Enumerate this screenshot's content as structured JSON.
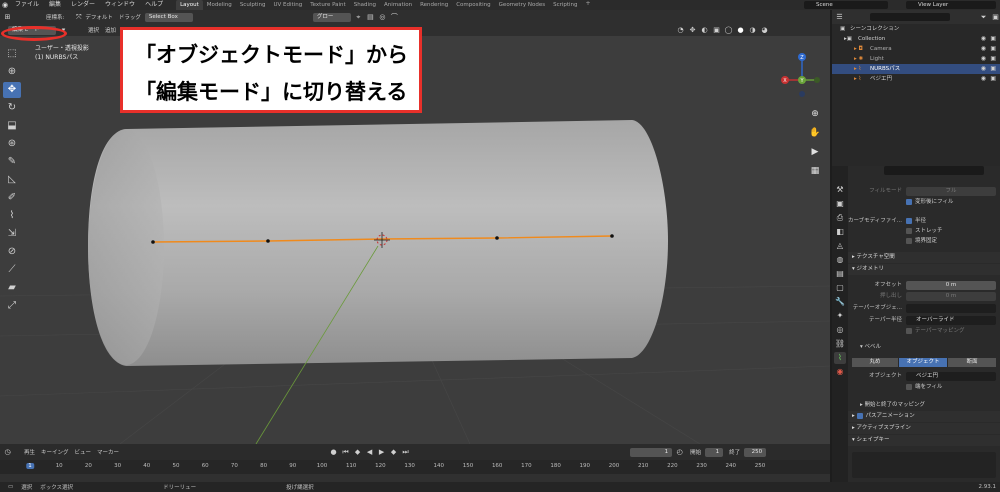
{
  "topbar": {
    "menus": [
      "ファイル",
      "編集",
      "レンダー",
      "ウィンドウ",
      "ヘルプ"
    ],
    "workspaces": [
      "Layout",
      "Modeling",
      "Sculpting",
      "UV Editing",
      "Texture Paint",
      "Shading",
      "Animation",
      "Rendering",
      "Compositing",
      "Geometry Nodes",
      "Scripting"
    ],
    "active_workspace": "Layout",
    "add_workspace": "+",
    "scene": "Scene",
    "view_layer": "View Layer"
  },
  "header1": {
    "transform_label": "座標系:",
    "orientation": "デフォルト",
    "drag_label": "ドラッグ",
    "select_mode": "Select Box",
    "pivot": "グロー"
  },
  "header2": {
    "mode": "編集モード",
    "menus": [
      "選択",
      "追加"
    ]
  },
  "viewport": {
    "view_name": "ユーザー・透視投影",
    "object_name": "(1) NURBSパス",
    "gizmo": {
      "x": "X",
      "y": "Y",
      "z": "Z"
    }
  },
  "annotation": {
    "line1": "「オブジェクトモード」から",
    "line2": "「編集モード」に切り替える",
    "border_color": "#e8302a"
  },
  "timeline": {
    "menus": [
      "再生",
      "キーイング",
      "ビュー",
      "マーカー"
    ],
    "current_frame": "1",
    "start_label": "開始",
    "start": "1",
    "end_label": "終了",
    "end": "250",
    "ticks": [
      "1",
      "10",
      "20",
      "30",
      "40",
      "50",
      "60",
      "70",
      "80",
      "90",
      "100",
      "110",
      "120",
      "130",
      "140",
      "150",
      "160",
      "170",
      "180",
      "190",
      "200",
      "210",
      "220",
      "230",
      "240",
      "250"
    ]
  },
  "statusbar": {
    "items": [
      "選択",
      "ボックス選択",
      "ドリーリュー",
      "投げ縄選択"
    ],
    "version": "2.93.1"
  },
  "outliner": {
    "root": "シーンコレクション",
    "items": [
      {
        "label": "Collection",
        "selected": false
      },
      {
        "label": "Camera",
        "selected": false
      },
      {
        "label": "Light",
        "selected": false
      },
      {
        "label": "NURBSパス",
        "selected": true
      },
      {
        "label": "ベジエ円",
        "selected": false
      }
    ]
  },
  "properties": {
    "fill_mode_label": "フィルモード",
    "fill_mode": "フル",
    "fill_deform": "変形後にフィル",
    "curve_modifier_label": "カーブモディファイ...",
    "radius": "半径",
    "stretch": "ストレッチ",
    "bounds_clamp": "境界固定",
    "texture_space": "テクスチャ空間",
    "geometry": "ジオメトリ",
    "offset_label": "オフセット",
    "offset": "0 m",
    "extrude_label": "押し出し",
    "extrude": "0 m",
    "taper_object_label": "テーパーオブジェ...",
    "taper_radius_label": "テーパー半径",
    "taper_radius": "オーバーライド",
    "taper_mapping": "テーパーマッピング",
    "bevel": "ベベル",
    "bevel_modes": [
      "丸め",
      "オブジェクト",
      "断面"
    ],
    "bevel_active": "オブジェクト",
    "object_label": "オブジェクト",
    "object_value": "ベジエ円",
    "fill_caps": "端をフィル",
    "start_end_mapping": "開始と終了のマッピング",
    "path_animation": "パスアニメーション",
    "active_spline": "アクティブスプライン",
    "shape_keys": "シェイプキー"
  }
}
